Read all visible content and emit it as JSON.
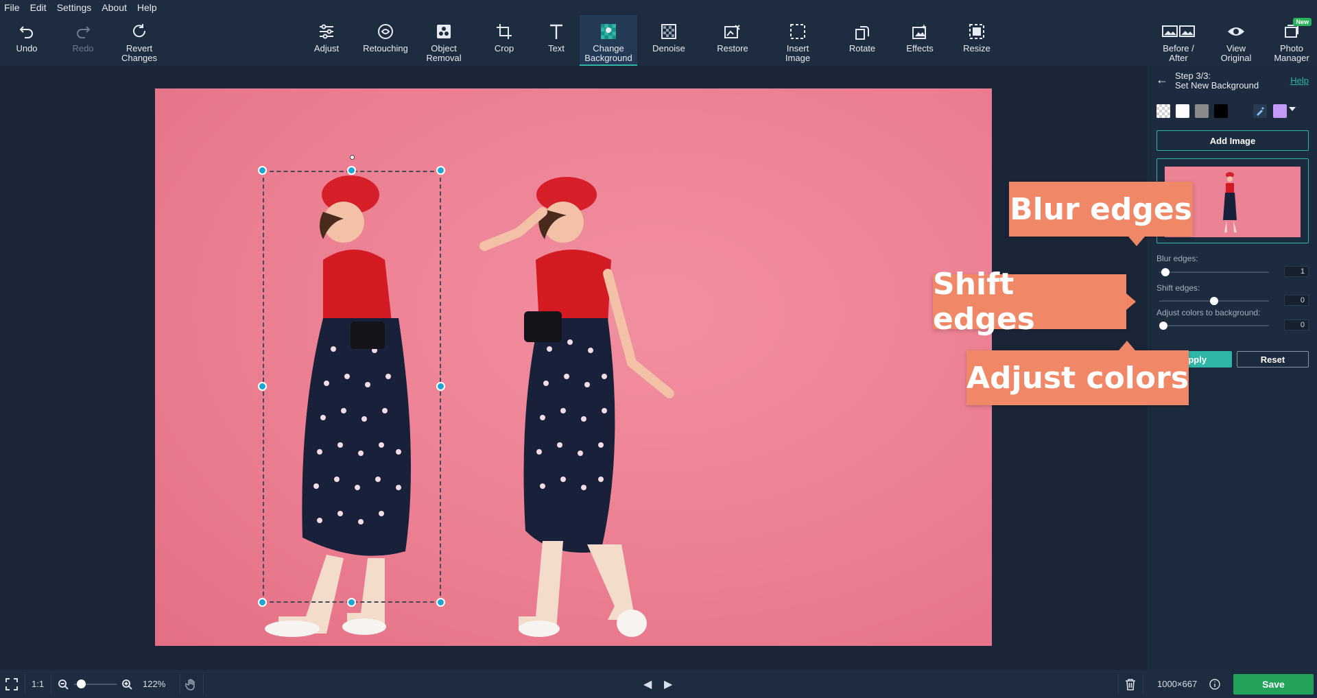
{
  "menu": [
    "File",
    "Edit",
    "Settings",
    "About",
    "Help"
  ],
  "toolbar": {
    "undo": "Undo",
    "redo": "Redo",
    "revert": "Revert\nChanges",
    "tools": [
      {
        "label": "Adjust",
        "icon": "sliders-icon"
      },
      {
        "label": "Retouching",
        "icon": "retouch-face-icon"
      },
      {
        "label": "Object\nRemoval",
        "icon": "object-removal-icon"
      },
      {
        "label": "Crop",
        "icon": "crop-icon"
      },
      {
        "label": "Text",
        "icon": "text-icon"
      },
      {
        "label": "Change\nBackground",
        "icon": "change-background-icon",
        "active": true
      },
      {
        "label": "Denoise",
        "icon": "denoise-icon"
      },
      {
        "label": "Restore",
        "icon": "restore-icon"
      },
      {
        "label": "Insert\nImage",
        "icon": "insert-image-icon"
      },
      {
        "label": "Rotate",
        "icon": "rotate-icon"
      },
      {
        "label": "Effects",
        "icon": "effects-icon"
      },
      {
        "label": "Resize",
        "icon": "resize-icon"
      }
    ],
    "before_after": "Before /\nAfter",
    "view_original": "View\nOriginal",
    "photo_manager": "Photo\nManager",
    "new_badge": "New"
  },
  "panel": {
    "step": "Step 3/3:",
    "step_title": "Set New Background",
    "help": "Help",
    "swatches": [
      "transparent",
      "#ffffff",
      "#8a8a8a",
      "#000000"
    ],
    "picked_color": "#c39af7",
    "add_image": "Add Image",
    "blur_label": "Blur edges:",
    "blur_value": "1",
    "blur_level": 0.02,
    "shift_label": "Shift edges:",
    "shift_value": "0",
    "shift_level": 0.5,
    "adjust_label": "Adjust colors to background:",
    "adjust_value": "0",
    "adjust_level": 0,
    "apply": "Apply",
    "reset": "Reset"
  },
  "callouts": {
    "blur": "Blur edges",
    "shift": "Shift edges",
    "adjust": "Adjust colors"
  },
  "status": {
    "one_to_one": "1:1",
    "zoom": "122%",
    "dimensions": "1000×667",
    "save": "Save"
  },
  "colors": {
    "accent": "#2fb6a6",
    "handle": "#1ea5d4",
    "callout": "#f08766",
    "save": "#23a35a"
  }
}
